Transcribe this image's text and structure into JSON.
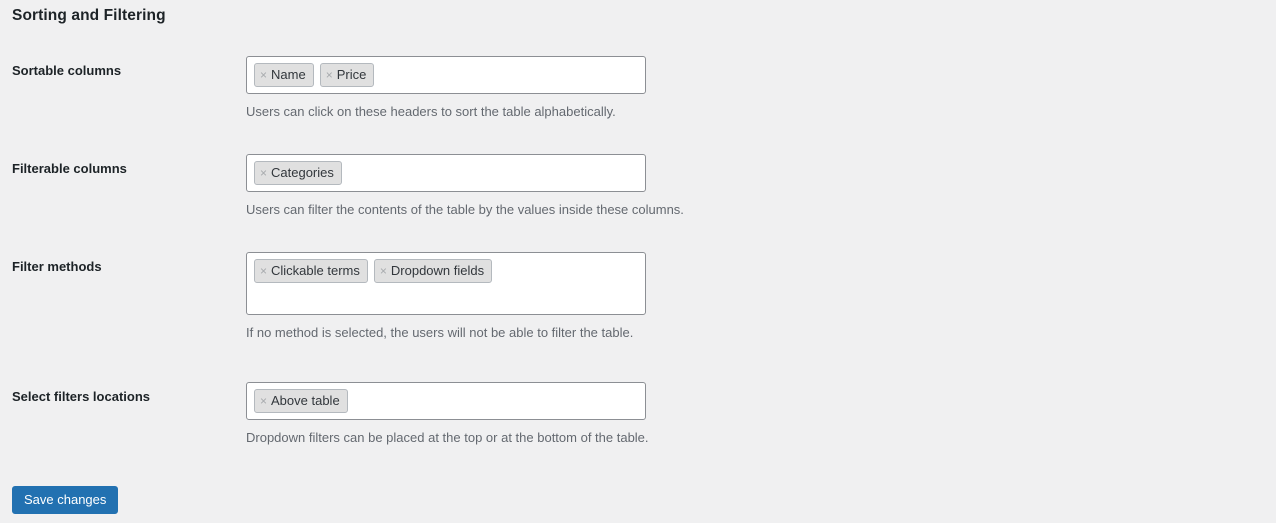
{
  "page": {
    "title": "Sorting and Filtering",
    "background_color": "#f0f0f1",
    "text_color": "#1d2327",
    "description_color": "#646970",
    "accent_color": "#2271b1"
  },
  "rows": [
    {
      "label": "Sortable columns",
      "chips": [
        {
          "remove": "×",
          "label": "Name"
        },
        {
          "remove": "×",
          "label": "Price"
        }
      ],
      "description": "Users can click on these headers to sort the table alphabetically."
    },
    {
      "label": "Filterable columns",
      "chips": [
        {
          "remove": "×",
          "label": "Categories"
        }
      ],
      "description": "Users can filter the contents of the table by the values inside these columns."
    },
    {
      "label": "Filter methods",
      "chips": [
        {
          "remove": "×",
          "label": "Clickable terms"
        },
        {
          "remove": "×",
          "label": "Dropdown fields"
        }
      ],
      "description": "If no method is selected, the users will not be able to filter the table."
    },
    {
      "label": "Select filters locations",
      "chips": [
        {
          "remove": "×",
          "label": "Above table"
        }
      ],
      "description": "Dropdown filters can be placed at the top or at the bottom of the table."
    }
  ],
  "submit": {
    "save_label": "Save changes"
  }
}
